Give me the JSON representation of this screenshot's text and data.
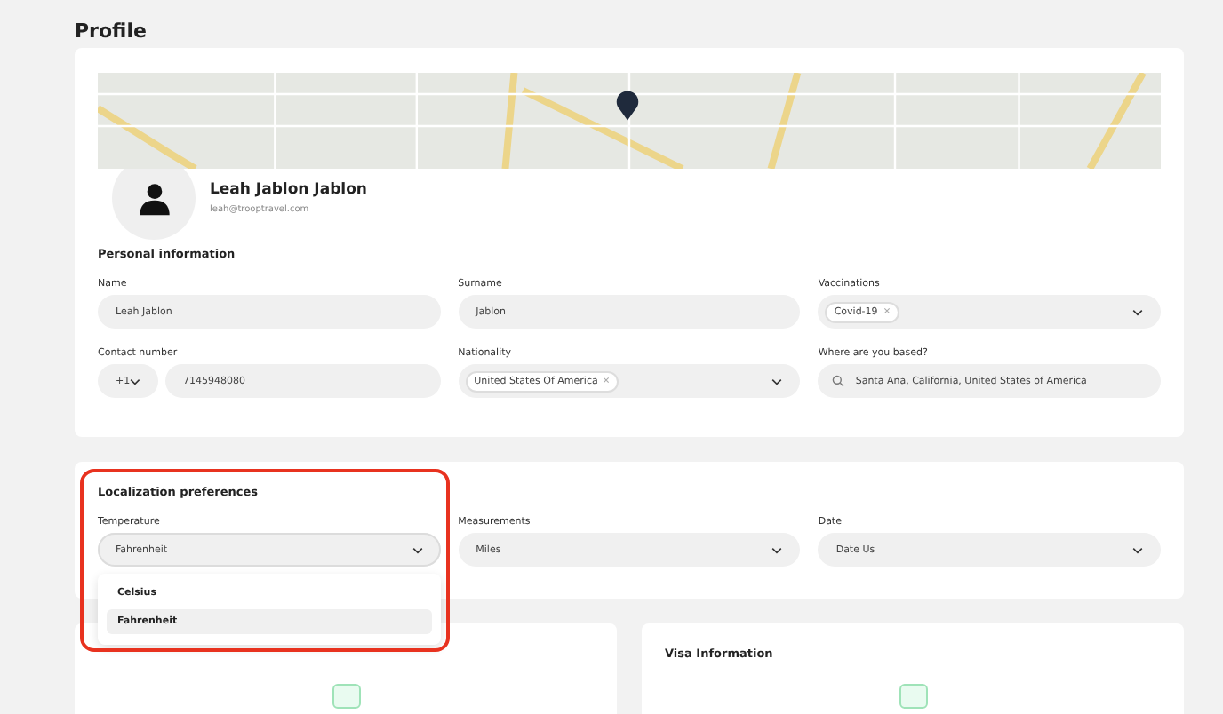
{
  "page": {
    "title": "Profile"
  },
  "profile": {
    "name": "Leah Jablon Jablon",
    "email": "leah@trooptravel.com"
  },
  "personal": {
    "title": "Personal information",
    "name": {
      "label": "Name",
      "value": "Leah Jablon"
    },
    "surname": {
      "label": "Surname",
      "value": "Jablon"
    },
    "vaccinations": {
      "label": "Vaccinations",
      "tags": [
        "Covid-19"
      ]
    },
    "contact": {
      "label": "Contact number",
      "code": "+1",
      "value": "7145948080"
    },
    "nationality": {
      "label": "Nationality",
      "tags": [
        "United States Of America"
      ]
    },
    "based": {
      "label": "Where are you based?",
      "value": "Santa Ana, California, United States of America"
    }
  },
  "localization": {
    "title": "Localization preferences",
    "fields": [
      {
        "label": "Temperature",
        "value": "Fahrenheit",
        "expanded": true,
        "options": [
          {
            "label": "Celsius",
            "selected": false
          },
          {
            "label": "Fahrenheit",
            "selected": true
          }
        ]
      },
      {
        "label": "Measurements",
        "value": "Miles",
        "expanded": false
      },
      {
        "label": "Date",
        "value": "Date Us",
        "expanded": false
      }
    ]
  },
  "visa": {
    "title": "Visa Information"
  }
}
